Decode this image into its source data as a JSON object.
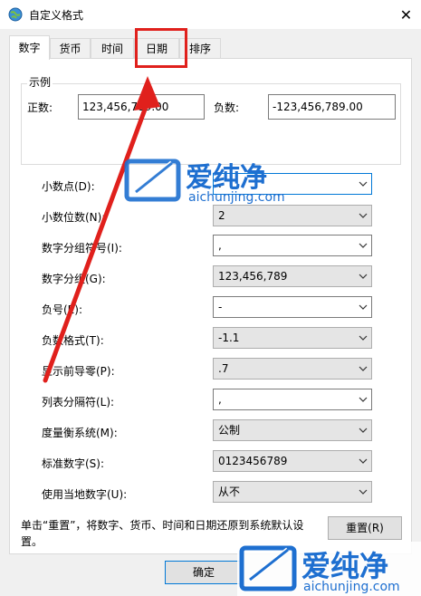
{
  "window": {
    "title": "自定义格式",
    "close_glyph": "✕"
  },
  "tabs": [
    {
      "label": "数字",
      "active": true
    },
    {
      "label": "货币",
      "active": false
    },
    {
      "label": "时间",
      "active": false
    },
    {
      "label": "日期",
      "active": false
    },
    {
      "label": "排序",
      "active": false
    }
  ],
  "sample": {
    "group_label": "示例",
    "positive_label": "正数:",
    "positive_value": "123,456,789.00",
    "negative_label": "负数:",
    "negative_value": "-123,456,789.00"
  },
  "settings": [
    {
      "label": "小数点(D):",
      "value": "."
    },
    {
      "label": "小数位数(N):",
      "value": "2"
    },
    {
      "label": "数字分组符号(I):",
      "value": ","
    },
    {
      "label": "数字分组(G):",
      "value": "123,456,789"
    },
    {
      "label": "负号(E):",
      "value": "-"
    },
    {
      "label": "负数格式(T):",
      "value": "-1.1"
    },
    {
      "label": "显示前导零(P):",
      "value": ".7"
    },
    {
      "label": "列表分隔符(L):",
      "value": ","
    },
    {
      "label": "度量衡系统(M):",
      "value": "公制"
    },
    {
      "label": "标准数字(S):",
      "value": "0123456789"
    },
    {
      "label": "使用当地数字(U):",
      "value": "从不"
    }
  ],
  "footer": {
    "note_line1": "单击“重置”，将数字、货币、时间和日期还原到系统默认设",
    "note_line2": "置。",
    "reset_label": "重置(R)",
    "ok_label": "确定"
  },
  "watermark": {
    "brand": "爱纯净",
    "url": "aichunjing.com"
  },
  "colors": {
    "annotation_red": "#e0201c",
    "watermark_blue": "#1e6fd0"
  }
}
